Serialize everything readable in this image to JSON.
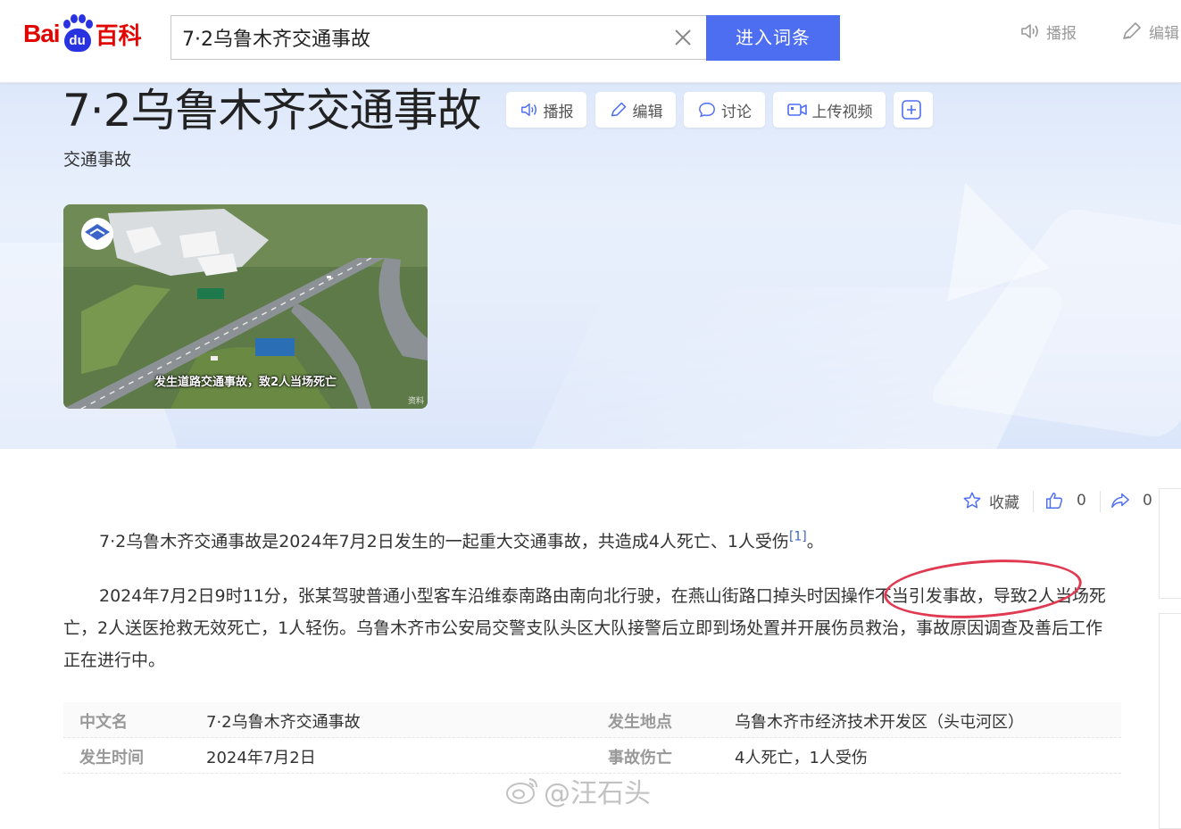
{
  "header": {
    "logo_text_bai": "Bai",
    "logo_text_du": "du",
    "logo_text_baike": "百科",
    "search_value": "7·2乌鲁木齐交通事故",
    "search_button": "进入词条",
    "broadcast_label": "播报",
    "edit_label": "编辑"
  },
  "banner": {
    "title": "7·2乌鲁木齐交通事故",
    "subtitle": "交通事故",
    "buttons": [
      "播报",
      "编辑",
      "讨论",
      "上传视频"
    ],
    "photo_caption": "发生道路交通事故，致2人当场死亡",
    "photo_watermark": "资料"
  },
  "actions": {
    "favorite_label": "收藏",
    "like_count": "0",
    "share_count": "0"
  },
  "body": {
    "p1_text": "7·2乌鲁木齐交通事故是2024年7月2日发生的一起重大交通事故，共造成4人死亡、1人受伤",
    "p1_ref": "[1]",
    "p1_end": "。",
    "p2_text": "2024年7月2日9时11分，张某驾驶普通小型客车沿维泰南路由南向北行驶，在燕山街路口掉头时因操作不当引发事故，导致2人当场死亡，2人送医抢救无效死亡，1人轻伤。乌鲁木齐市公安局交警支队头区大队接警后立即到场处置并开展伤员救治，事故原因调查及善后工作正在进行中。"
  },
  "infobox": {
    "rows": [
      {
        "k1": "中文名",
        "v1": "7·2乌鲁木齐交通事故",
        "k2": "发生地点",
        "v2": "乌鲁木齐市经济技术开发区（头屯河区）"
      },
      {
        "k1": "发生时间",
        "v1": "2024年7月2日",
        "k2": "事故伤亡",
        "v2": "4人死亡，1人受伤"
      }
    ]
  },
  "watermark": "@汪石头",
  "colors": {
    "brand_red": "#e10601",
    "brand_blue": "#2932e1",
    "search_button": "#4e6ef2",
    "annotation": "#e03a52",
    "link": "#3a64c8"
  }
}
